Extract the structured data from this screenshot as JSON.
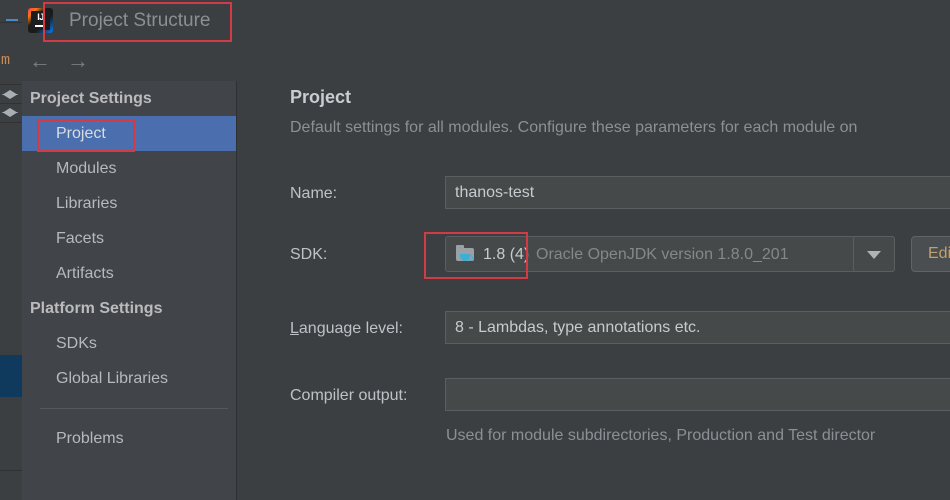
{
  "window": {
    "title": "Project Structure",
    "logo_icon": "intellij-idea-logo",
    "back_icon": "←",
    "forward_icon": "→"
  },
  "sidebar": {
    "groups": [
      {
        "header": "Project Settings",
        "items": [
          {
            "label": "Project",
            "selected": true
          },
          {
            "label": "Modules",
            "selected": false
          },
          {
            "label": "Libraries",
            "selected": false
          },
          {
            "label": "Facets",
            "selected": false
          },
          {
            "label": "Artifacts",
            "selected": false
          }
        ]
      },
      {
        "header": "Platform Settings",
        "items": [
          {
            "label": "SDKs",
            "selected": false
          },
          {
            "label": "Global Libraries",
            "selected": false
          }
        ]
      }
    ],
    "footer_items": [
      {
        "label": "Problems",
        "selected": false
      }
    ]
  },
  "main": {
    "title": "Project",
    "description": "Default settings for all modules. Configure these parameters for each module on",
    "fields": {
      "name": {
        "label": "Name:",
        "value": "thanos-test"
      },
      "sdk": {
        "label": "SDK:",
        "icon": "java-sdk-folder-icon",
        "value": "1.8 (4)",
        "detail": "Oracle OpenJDK version 1.8.0_201",
        "dropdown_icon": "chevron-down-icon",
        "edit_button": "Edit"
      },
      "language_level": {
        "label_mnemonic": "L",
        "label_rest": "anguage level:",
        "value": "8 - Lambdas, type annotations etc."
      },
      "compiler_output": {
        "label": "Compiler output:",
        "value": "",
        "hint": "Used for module subdirectories, Production and Test director"
      }
    }
  },
  "background": {
    "editor_letter": "m"
  },
  "annotations": {
    "accent_color": "#d33a45",
    "boxes": [
      "title-box",
      "sidebar-project-box",
      "sdk-value-box"
    ]
  },
  "colors": {
    "dialog_bg": "#3c3f41",
    "sidebar_bg": "#41454a",
    "selection_blue": "#4b6eaf",
    "field_bg": "#45494a",
    "annotation_red": "#d33a45"
  }
}
